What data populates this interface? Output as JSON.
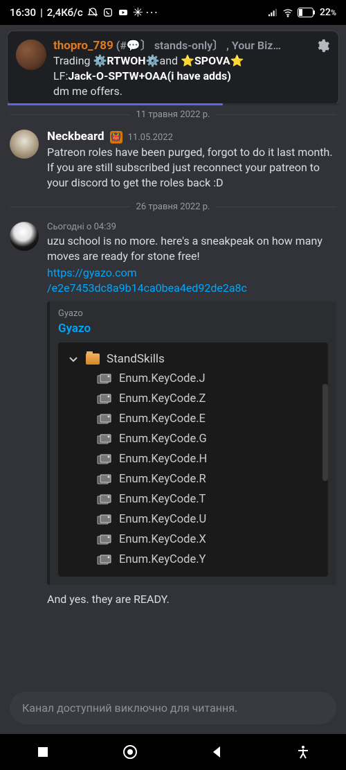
{
  "status": {
    "time": "16:30",
    "net": "2,4Кб/с",
    "battery": "22",
    "battery_suffix": "%"
  },
  "reply": {
    "user": "thopro_789",
    "channel_prefix": "(#💬〕 stands-only〕",
    "channel_suffix": ", Your Biz…",
    "line1_a": "Trading ",
    "line1_b": "RTWOH",
    "line1_c": "and ",
    "line1_d": "SPOVA",
    "line2_a": "LF:",
    "line2_b": "Jack-O-SPTW+OAA(i have adds)",
    "line3": "dm me offers."
  },
  "div1": "11 травня 2022 р.",
  "msg1": {
    "user": "Nеckbeard",
    "time": "11.05.2022",
    "text": "Patreon roles have been purged, forgot to do it last month. If you are still subscribed just reconnect your patreon to your discord to get the roles back :D"
  },
  "div2": "26 травня 2022 р.",
  "msg2": {
    "time": "Сьогодні о 04:39",
    "text": "uzu school is no more. here's a sneakpeak on how many moves are ready for stone free!",
    "link1": "https://gyazo.com",
    "link2": "/e2e7453dc8a9b14ca0bea4ed92de2a8c",
    "followup": "And yes. they are READY."
  },
  "embed": {
    "site": "Gyazo",
    "title": "Gyazo",
    "folder": "StandSkills",
    "items": [
      "Enum.KeyCode.J",
      "Enum.KeyCode.Z",
      "Enum.KeyCode.E",
      "Enum.KeyCode.G",
      "Enum.KeyCode.H",
      "Enum.KeyCode.R",
      "Enum.KeyCode.T",
      "Enum.KeyCode.U",
      "Enum.KeyCode.X",
      "Enum.KeyCode.Y"
    ]
  },
  "readonly": "Канал доступний виключно для читання."
}
